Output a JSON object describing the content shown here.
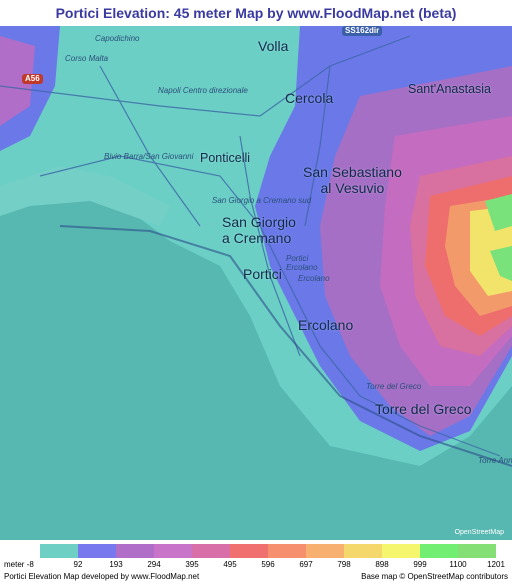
{
  "title": "Portici Elevation: 45 meter Map by www.FloodMap.net (beta)",
  "places": {
    "volla": "Volla",
    "sant_anastasia": "Sant'Anastasia",
    "cercola": "Cercola",
    "ponticelli": "Ponticelli",
    "san_sebastiano": "San Sebastiano\nal Vesuvio",
    "san_giorgio": "San Giorgio\na Cremano",
    "portici": "Portici",
    "ercolano": "Ercolano",
    "torre_del_greco": "Torre del Greco"
  },
  "roads": {
    "capodichino": "Capodichino",
    "corso_malta": "Corso Malta",
    "napoli_centro": "Napoli Centro direzionale",
    "bivio_barra": "Bivio Barra/San Giovanni",
    "san_giorgio_sud": "San Giorgio a Cremano sud",
    "portici_ercolano": "Portici\nErcolano",
    "ercolano_small": "Ercolano",
    "torre_small": "Torre del Greco",
    "torre_annunziata": "Torre Ann",
    "a56": "A56",
    "ss162": "SS162dir"
  },
  "osm_badge": "OpenStreetMap",
  "legend": {
    "unit_label": "meter -8",
    "ticks": [
      "92",
      "193",
      "294",
      "395",
      "495",
      "596",
      "697",
      "798",
      "898",
      "999",
      "1100",
      "1201"
    ],
    "colors": [
      "#6ecfc4",
      "#7777ee",
      "#b06ec8",
      "#c874c8",
      "#d86fa8",
      "#f07070",
      "#f58f6e",
      "#f8b070",
      "#f5d86c",
      "#f5f56e",
      "#72ee72",
      "#84e074"
    ]
  },
  "footer": {
    "left": "Portici Elevation Map developed by www.FloodMap.net",
    "right": "Base map © OpenStreetMap contributors"
  }
}
